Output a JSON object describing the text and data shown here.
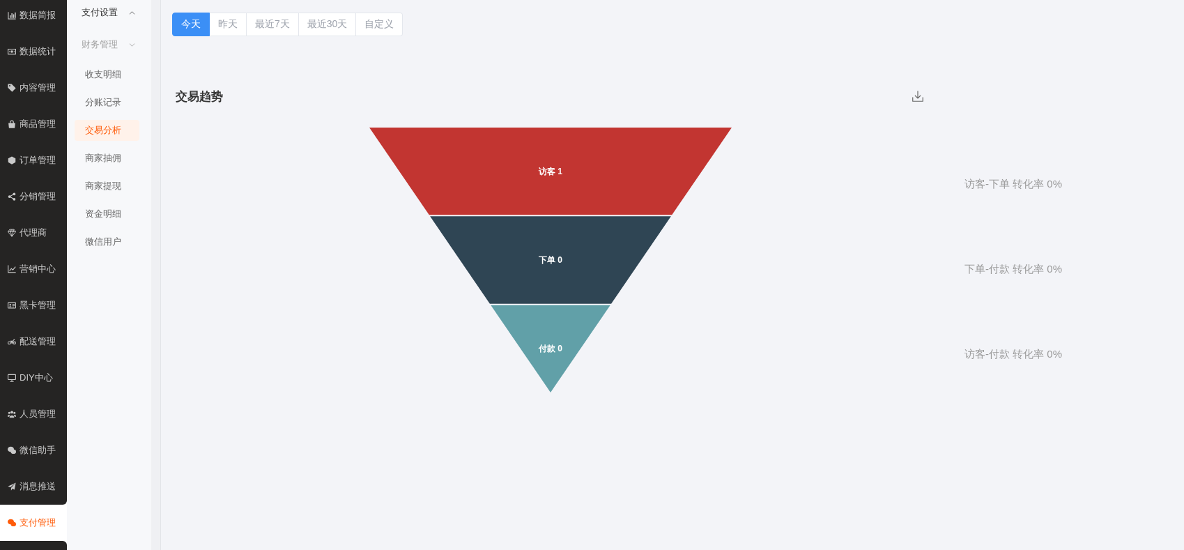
{
  "sidebar": {
    "items": [
      {
        "label": "数据简报",
        "selected": false
      },
      {
        "label": "数据统计",
        "selected": false
      },
      {
        "label": "内容管理",
        "selected": false
      },
      {
        "label": "商品管理",
        "selected": false
      },
      {
        "label": "订单管理",
        "selected": false
      },
      {
        "label": "分销管理",
        "selected": false
      },
      {
        "label": "代理商",
        "selected": false
      },
      {
        "label": "营销中心",
        "selected": false
      },
      {
        "label": "黑卡管理",
        "selected": false
      },
      {
        "label": "配送管理",
        "selected": false
      },
      {
        "label": "DIY中心",
        "selected": false
      },
      {
        "label": "人员管理",
        "selected": false
      },
      {
        "label": "微信助手",
        "selected": false
      },
      {
        "label": "消息推送",
        "selected": false
      },
      {
        "label": "支付管理",
        "selected": true
      }
    ]
  },
  "submenu": {
    "groups": [
      {
        "label": "支付设置",
        "expanded": false
      },
      {
        "label": "财务管理",
        "expanded": true,
        "children": [
          {
            "label": "收支明细",
            "selected": false
          },
          {
            "label": "分账记录",
            "selected": false
          },
          {
            "label": "交易分析",
            "selected": true
          },
          {
            "label": "商家抽佣",
            "selected": false
          },
          {
            "label": "商家提现",
            "selected": false
          },
          {
            "label": "资金明细",
            "selected": false
          },
          {
            "label": "微信用户",
            "selected": false
          }
        ]
      }
    ]
  },
  "date_tabs": [
    {
      "label": "今天",
      "selected": true
    },
    {
      "label": "昨天",
      "selected": false
    },
    {
      "label": "最近7天",
      "selected": false
    },
    {
      "label": "最近30天",
      "selected": false
    },
    {
      "label": "自定义",
      "selected": false
    }
  ],
  "chart_panel": {
    "title": "交易趋势",
    "funnel": {
      "stages": [
        {
          "label": "访客 1",
          "color": "#c23531"
        },
        {
          "label": "下单 0",
          "color": "#2f4554"
        },
        {
          "label": "付款 0",
          "color": "#61a0a8"
        }
      ]
    },
    "conversions": [
      "访客-下单 转化率 0%",
      "下单-付款 转化率 0%",
      "访客-付款 转化率 0%"
    ]
  }
}
